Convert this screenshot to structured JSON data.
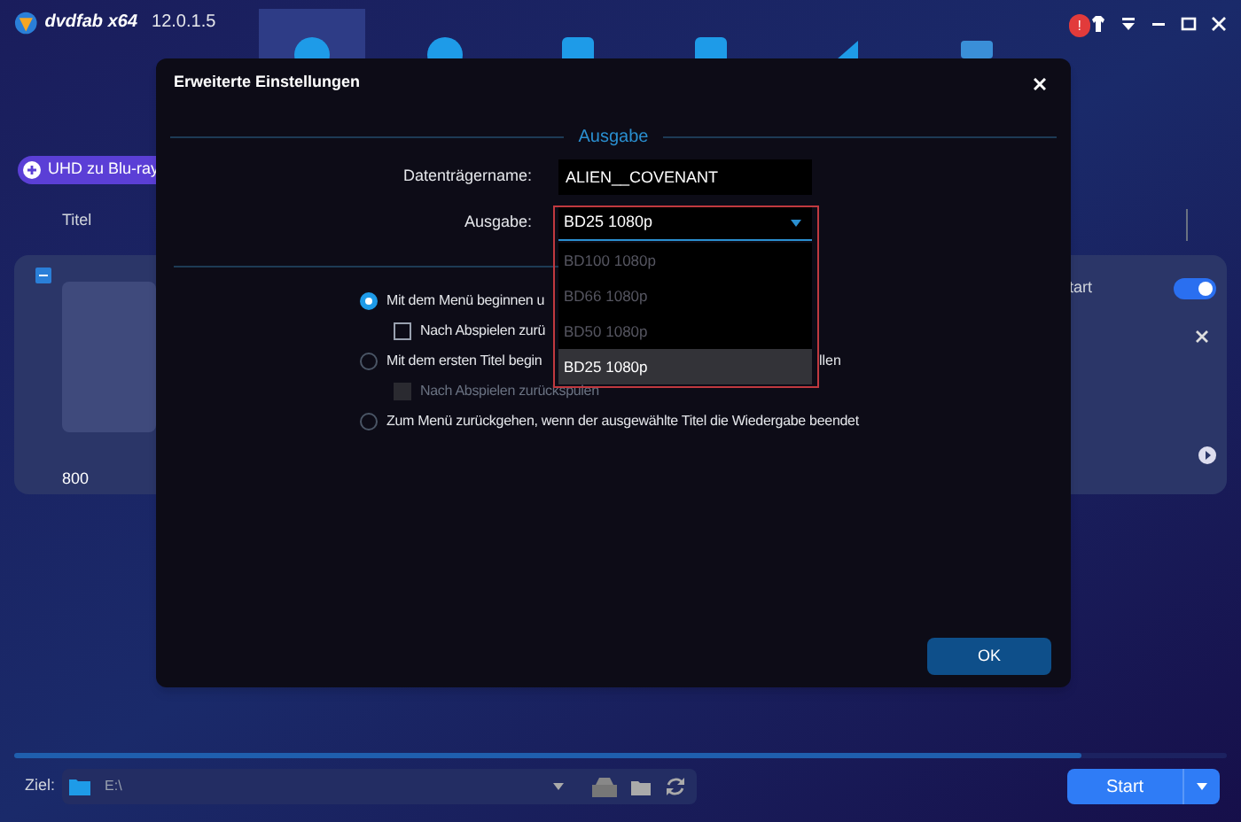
{
  "app": {
    "logo_text": "dvdfab x64",
    "version": "12.0.1.5",
    "nav_items": [
      {
        "selected": true
      },
      {
        "selected": false
      },
      {
        "selected": false
      },
      {
        "selected": false
      },
      {
        "selected": false
      },
      {
        "selected": false
      }
    ],
    "notification_badge": "!",
    "source_button": "UHD zu Blu-ray",
    "column_header": "Titel",
    "title_card": {
      "selected": true,
      "duration": "800",
      "option_label": "tart",
      "toggle_on": true
    },
    "progress": {
      "level": 0.88
    },
    "destination": {
      "label": "Ziel:",
      "path": "E:\\"
    },
    "start_button": "Start"
  },
  "dialog": {
    "title": "Erweiterte Einstellungen",
    "section": "Ausgabe",
    "disc_name": {
      "label": "Datenträgername:",
      "value": "ALIEN__COVENANT"
    },
    "output": {
      "label": "Ausgabe:",
      "value": "BD25 1080p",
      "expanded": true,
      "options": [
        {
          "label": "BD100 1080p",
          "selected": false
        },
        {
          "label": "BD66 1080p",
          "selected": false
        },
        {
          "label": "BD50 1080p",
          "selected": false
        },
        {
          "label": "BD25 1080p",
          "selected": true
        }
      ]
    },
    "menu_options": [
      {
        "kind": "radio",
        "text": "Mit dem Menü beginnen u",
        "checked": true,
        "disabled": false
      },
      {
        "kind": "checkbox",
        "text": "Nach Abspielen zurü",
        "checked": false,
        "disabled": false
      },
      {
        "kind": "radio",
        "text": "Mit dem ersten Titel begin",
        "text_after": "llen",
        "checked": false,
        "disabled": false
      },
      {
        "kind": "checkbox",
        "text": "Nach Abspielen zurückspulen",
        "checked": false,
        "disabled": true
      },
      {
        "kind": "radio",
        "text": "Zum Menü zurückgehen, wenn der ausgewählte Titel die Wiedergabe beendet",
        "checked": false,
        "disabled": false
      }
    ],
    "ok_button": "OK"
  }
}
